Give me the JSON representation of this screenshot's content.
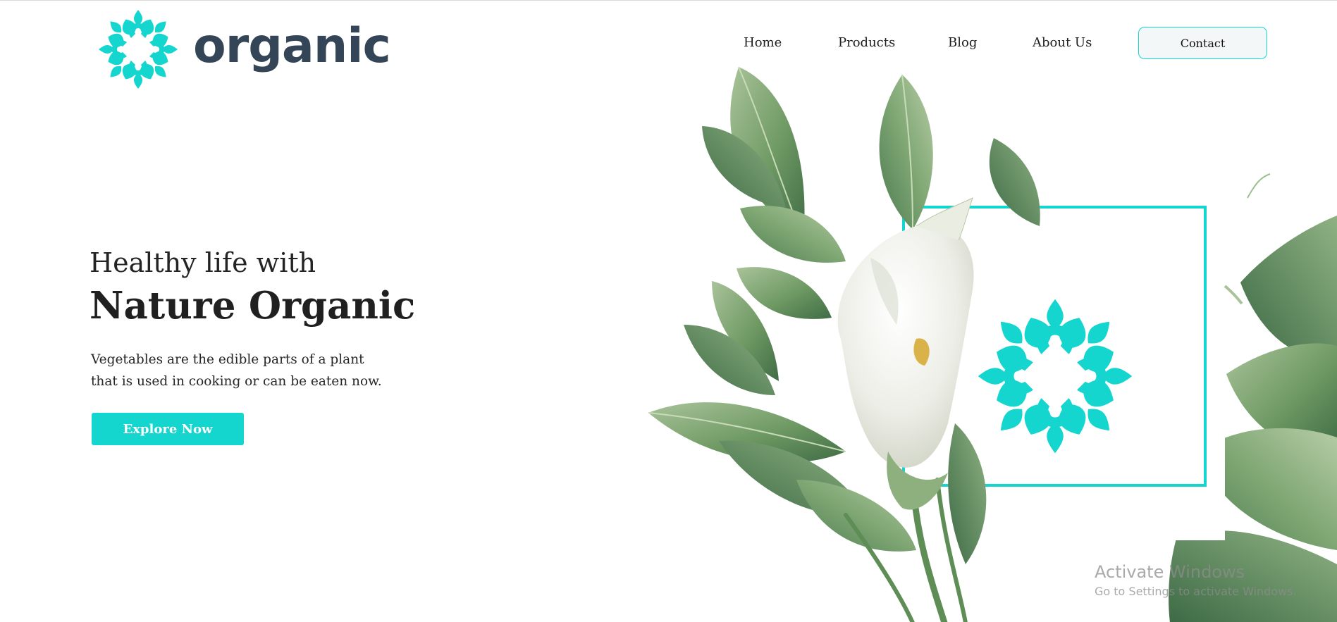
{
  "brand": {
    "name": "organic",
    "accent_color": "#14d6cf",
    "text_color": "#344557",
    "logo_icon": "mandala-icon"
  },
  "nav": {
    "items": [
      {
        "label": "Home"
      },
      {
        "label": "Products"
      },
      {
        "label": "Blog"
      },
      {
        "label": "About Us"
      }
    ],
    "contact_label": "Contact"
  },
  "hero": {
    "subtitle": "Healthy life with",
    "title": "Nature Organic",
    "description_lines": [
      "Vegetables are the edible parts of a plant",
      "that is used in cooking or can be eaten now."
    ],
    "cta_label": "Explore Now"
  },
  "illustration": {
    "subject": "calla-lily-with-leaves",
    "frame_color": "#14d6cf"
  },
  "watermark": {
    "title": "Activate Windows",
    "subtitle": "Go to Settings to activate Windows."
  }
}
